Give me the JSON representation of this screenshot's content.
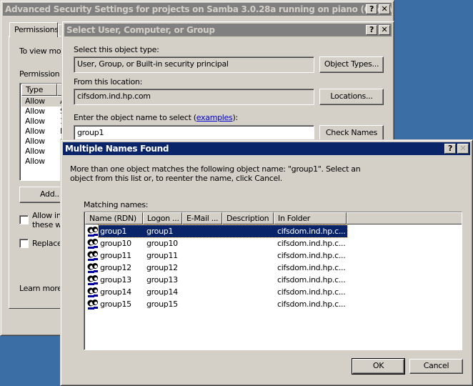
{
  "desktop_color": "#3a6ea5",
  "main_window": {
    "title": "Advanced Security Settings for projects on Samba 3.0.28a running on piano (OpenVMS) ...",
    "tabs": [
      {
        "label": "Permissions"
      },
      {
        "label": "A"
      }
    ],
    "intro_text": "To view more",
    "permission_label": "Permission en",
    "list_headers": {
      "type": "Type",
      "name": "N"
    },
    "rows": [
      {
        "type": "Allow",
        "name": "A"
      },
      {
        "type": "Allow",
        "name": "S"
      },
      {
        "type": "Allow",
        "name": "1"
      },
      {
        "type": "Allow",
        "name": "E"
      },
      {
        "type": "Allow",
        "name": "C"
      },
      {
        "type": "Allow",
        "name": ""
      },
      {
        "type": "Allow",
        "name": ""
      }
    ],
    "add_label": "Add..",
    "inherit_line1": "Allow inh",
    "inherit_line2": "these wi",
    "replace_label": "Replace",
    "learn_more": "Learn more a"
  },
  "select_dialog": {
    "title": "Select User, Computer, or Group",
    "object_type_label": "Select this object type:",
    "object_type_value": "User, Group, or Built-in security principal",
    "object_types_button": "Object Types...",
    "location_label": "From this location:",
    "location_value": "cifsdom.ind.hp.com",
    "locations_button": "Locations...",
    "enter_label_pre": "Enter the object name to select (",
    "examples_link": "examples",
    "enter_label_post": "):",
    "object_name_value": "group1",
    "check_names_button": "Check Names"
  },
  "multiple_dialog": {
    "title": "Multiple Names Found",
    "message_line1": "More than one object matches the following object name: \"group1\". Select an",
    "message_line2": "object from this list or, to reenter the name, click Cancel.",
    "matching_label": "Matching names:",
    "columns": [
      "Name (RDN)",
      "Logon ...",
      "E-Mail ...",
      "Description",
      "In Folder"
    ],
    "rows": [
      {
        "name": "group1",
        "logon": "group1",
        "email": "",
        "description": "",
        "folder": "cifsdom.ind.hp.c...",
        "selected": true
      },
      {
        "name": "group10",
        "logon": "group10",
        "email": "",
        "description": "",
        "folder": "cifsdom.ind.hp.c..."
      },
      {
        "name": "group11",
        "logon": "group11",
        "email": "",
        "description": "",
        "folder": "cifsdom.ind.hp.c..."
      },
      {
        "name": "group12",
        "logon": "group12",
        "email": "",
        "description": "",
        "folder": "cifsdom.ind.hp.c..."
      },
      {
        "name": "group13",
        "logon": "group13",
        "email": "",
        "description": "",
        "folder": "cifsdom.ind.hp.c..."
      },
      {
        "name": "group14",
        "logon": "group14",
        "email": "",
        "description": "",
        "folder": "cifsdom.ind.hp.c..."
      },
      {
        "name": "group15",
        "logon": "group15",
        "email": "",
        "description": "",
        "folder": "cifsdom.ind.hp.c..."
      }
    ],
    "ok_button": "OK",
    "cancel_button": "Cancel"
  },
  "title_buttons": {
    "help": "?",
    "close": "✕"
  }
}
